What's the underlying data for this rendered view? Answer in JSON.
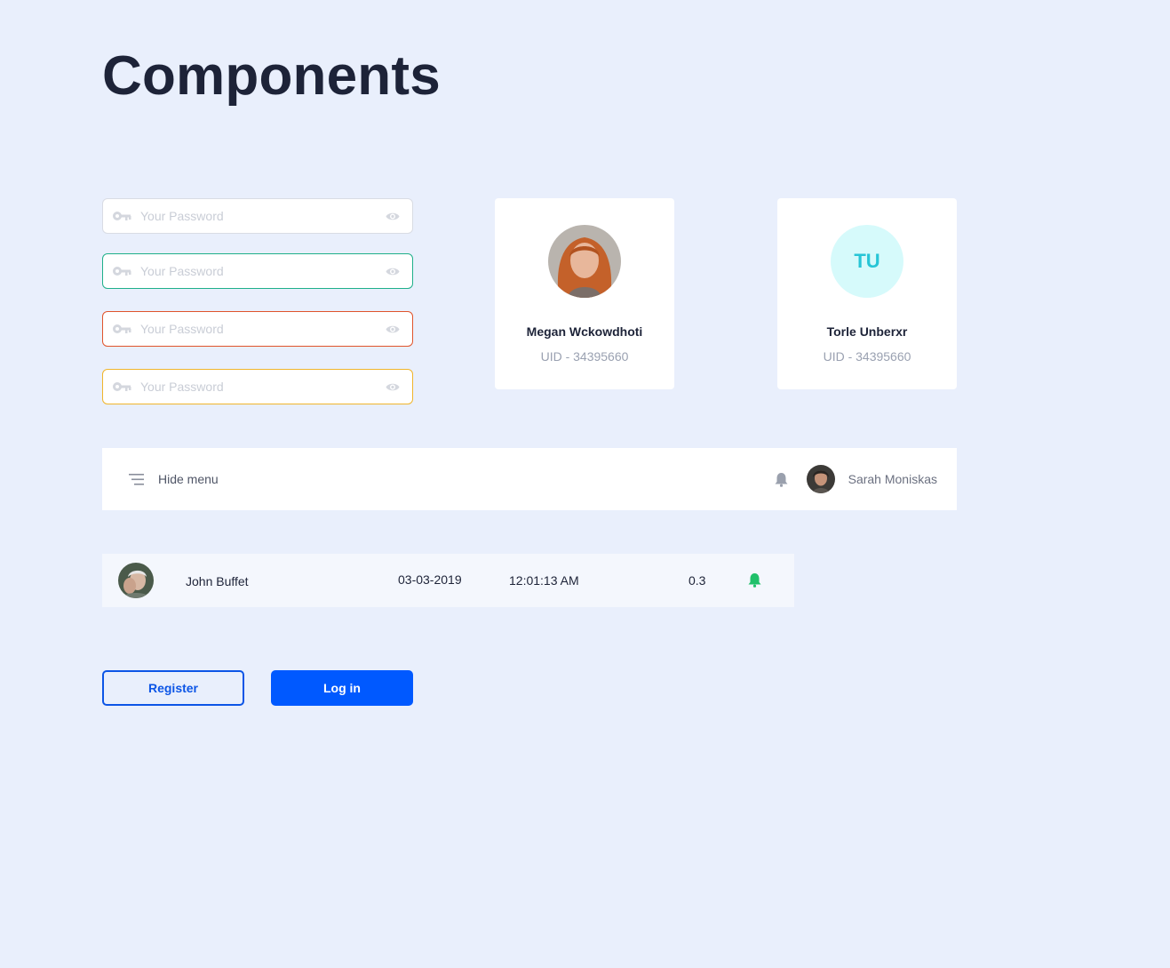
{
  "page": {
    "title": "Components"
  },
  "password_fields": [
    {
      "placeholder": "Your Password",
      "state": "default",
      "border_color": "#d9dce4"
    },
    {
      "placeholder": "Your Password",
      "state": "success",
      "border_color": "#1fb08a"
    },
    {
      "placeholder": "Your Password",
      "state": "error",
      "border_color": "#e0542c"
    },
    {
      "placeholder": "Your Password",
      "state": "warning",
      "border_color": "#f0b52c"
    }
  ],
  "user_cards": [
    {
      "name": "Megan Wckowdhoti",
      "uid": "UID - 34395660",
      "avatar": "photo"
    },
    {
      "name": "Torle Unberxr",
      "uid": "UID - 34395660",
      "initials": "TU"
    }
  ],
  "topbar": {
    "menu_label": "Hide menu",
    "user_name": "Sarah Moniskas",
    "icons": [
      "menu-lines-icon",
      "bell-icon"
    ]
  },
  "table_row": {
    "name": "John Buffet",
    "date": "03-03-2019",
    "time": "12:01:13 AM",
    "value": "0.3",
    "status_icon": "bell-icon",
    "status_color": "#20c06a"
  },
  "buttons": {
    "register_label": "Register",
    "login_label": "Log in"
  },
  "colors": {
    "background": "#e9effc",
    "primary": "#0059ff",
    "accent_cyan": "#27c5d6"
  }
}
